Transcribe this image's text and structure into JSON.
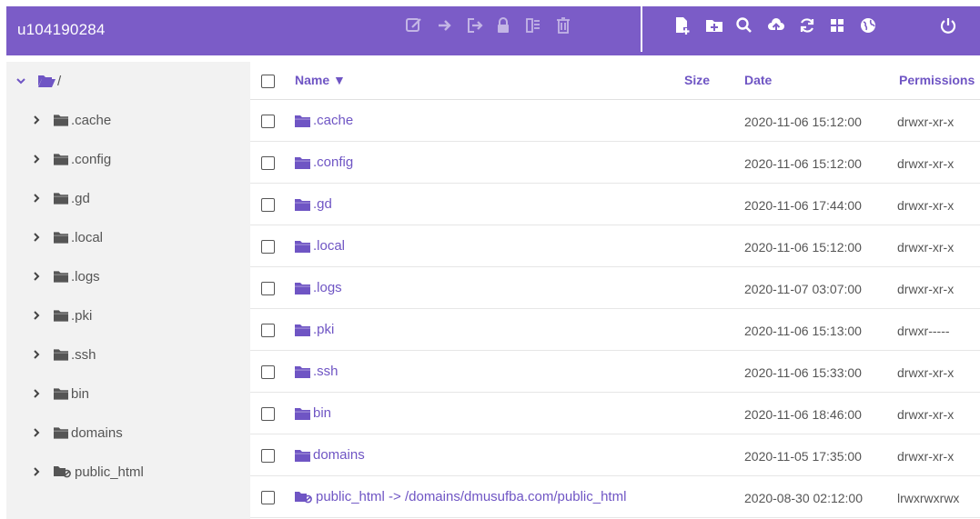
{
  "header": {
    "title": "u104190284",
    "toolbar_left": [
      "edit-icon",
      "move-icon",
      "export-icon",
      "lock-icon",
      "compress-icon",
      "trash-icon"
    ],
    "toolbar_right": [
      "new-file-icon",
      "new-folder-icon",
      "search-icon",
      "upload-icon",
      "refresh-icon",
      "grid-view-icon",
      "globe-icon",
      "power-icon"
    ]
  },
  "colors": {
    "accent": "#7b5cc7",
    "link": "#6f55c4",
    "folder": "#6f55c4"
  },
  "sidebar": {
    "root_label": "/",
    "items": [
      {
        "label": ".cache",
        "icon": "folder-icon"
      },
      {
        "label": ".config",
        "icon": "folder-icon"
      },
      {
        "label": ".gd",
        "icon": "folder-icon"
      },
      {
        "label": ".local",
        "icon": "folder-icon"
      },
      {
        "label": ".logs",
        "icon": "folder-icon"
      },
      {
        "label": ".pki",
        "icon": "folder-icon"
      },
      {
        "label": ".ssh",
        "icon": "folder-icon"
      },
      {
        "label": "bin",
        "icon": "folder-icon"
      },
      {
        "label": "domains",
        "icon": "folder-icon"
      },
      {
        "label": "public_html",
        "icon": "folder-link-icon"
      }
    ]
  },
  "table": {
    "columns": {
      "name": "Name ▼",
      "size": "Size",
      "date": "Date",
      "permissions": "Permissions"
    },
    "rows": [
      {
        "name": ".cache",
        "date": "2020-11-06 15:12:00",
        "perm": "drwxr-xr-x",
        "icon": "folder-icon"
      },
      {
        "name": ".config",
        "date": "2020-11-06 15:12:00",
        "perm": "drwxr-xr-x",
        "icon": "folder-icon"
      },
      {
        "name": ".gd",
        "date": "2020-11-06 17:44:00",
        "perm": "drwxr-xr-x",
        "icon": "folder-icon"
      },
      {
        "name": ".local",
        "date": "2020-11-06 15:12:00",
        "perm": "drwxr-xr-x",
        "icon": "folder-icon"
      },
      {
        "name": ".logs",
        "date": "2020-11-07 03:07:00",
        "perm": "drwxr-xr-x",
        "icon": "folder-icon"
      },
      {
        "name": ".pki",
        "date": "2020-11-06 15:13:00",
        "perm": "drwxr-----",
        "icon": "folder-icon"
      },
      {
        "name": ".ssh",
        "date": "2020-11-06 15:33:00",
        "perm": "drwxr-xr-x",
        "icon": "folder-icon"
      },
      {
        "name": "bin",
        "date": "2020-11-06 18:46:00",
        "perm": "drwxr-xr-x",
        "icon": "folder-icon"
      },
      {
        "name": "domains",
        "date": "2020-11-05 17:35:00",
        "perm": "drwxr-xr-x",
        "icon": "folder-icon"
      },
      {
        "name": "public_html -> /domains/dmusufba.com/public_html",
        "date": "2020-08-30 02:12:00",
        "perm": "lrwxrwxrwx",
        "icon": "folder-link-icon"
      }
    ]
  }
}
